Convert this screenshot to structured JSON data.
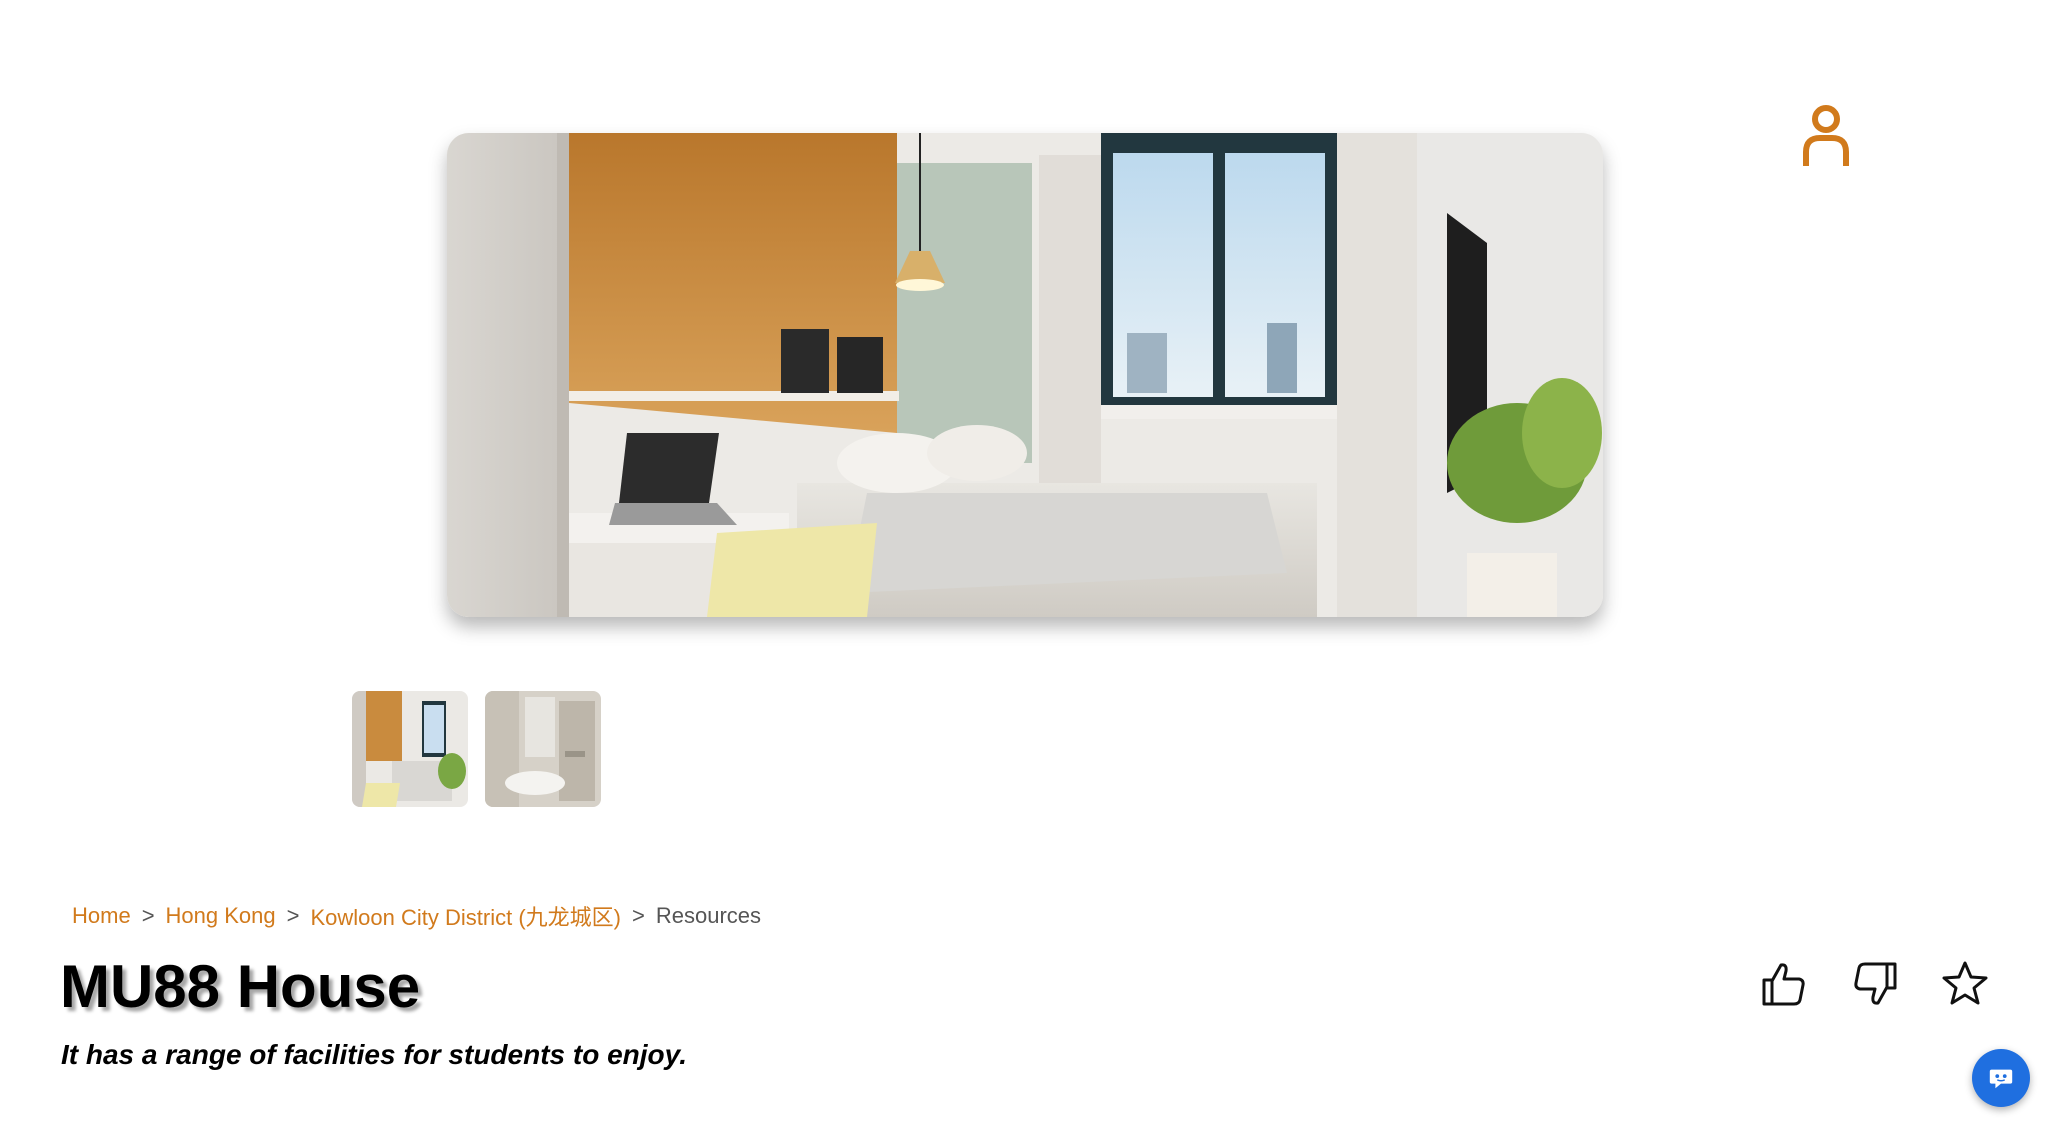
{
  "header": {
    "user_icon": "user-icon",
    "accent_color": "#d17a1c"
  },
  "gallery": {
    "main_image_alt": "bedroom-photo",
    "thumbnails": [
      {
        "alt": "bedroom-thumbnail"
      },
      {
        "alt": "bathroom-thumbnail"
      }
    ]
  },
  "breadcrumb": {
    "items": [
      "Home",
      "Hong Kong",
      "Kowloon City District (九龙城区)"
    ],
    "separator": ">",
    "current": "Resources"
  },
  "listing": {
    "title": "MU88 House",
    "subtitle": "It has a range of facilities for students to enjoy."
  },
  "actions": {
    "like_icon": "thumbs-up-icon",
    "dislike_icon": "thumbs-down-icon",
    "favorite_icon": "star-icon"
  },
  "chat": {
    "icon": "chat-bot-icon",
    "color": "#1f6fe0"
  }
}
